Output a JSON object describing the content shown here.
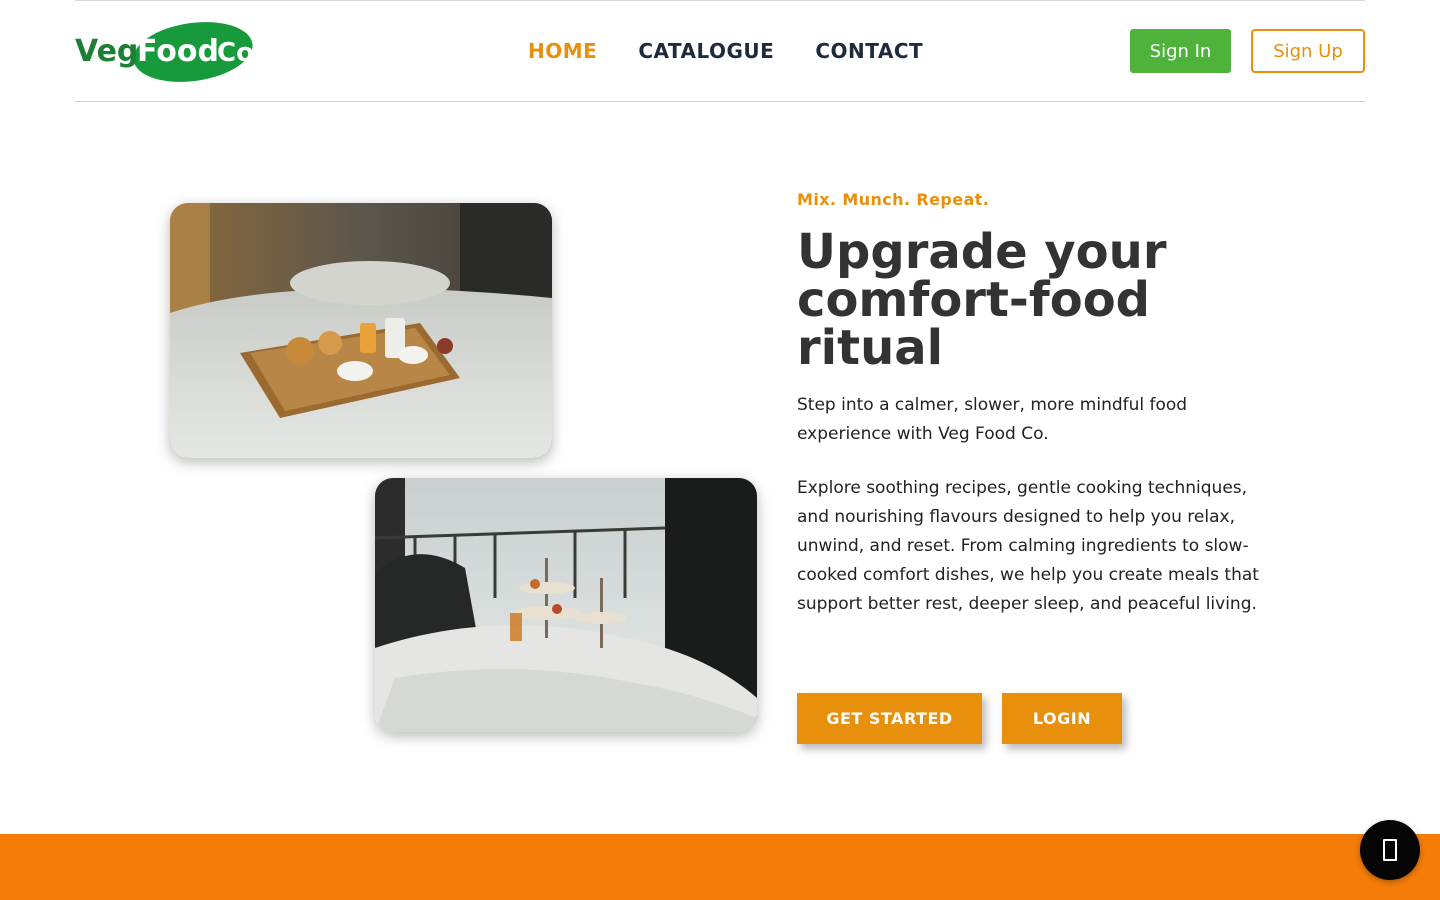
{
  "brand": {
    "logo_text_left": "Veg",
    "logo_text_mid": "Food",
    "logo_text_right": "Co.",
    "colors": {
      "green": "#1c9a3a",
      "orange": "#e8900c",
      "band": "#f57c08"
    }
  },
  "nav": {
    "items": [
      {
        "label": "HOME",
        "active": true
      },
      {
        "label": "CATALOGUE",
        "active": false
      },
      {
        "label": "CONTACT",
        "active": false
      }
    ]
  },
  "auth": {
    "sign_in": "Sign In",
    "sign_up": "Sign Up"
  },
  "hero": {
    "eyebrow": "Mix. Munch. Repeat.",
    "headline": "Upgrade your comfort-food ritual",
    "paragraph1": "Step into a calmer, slower, more mindful food experience with Veg Food Co.",
    "paragraph2": "Explore soothing recipes, gentle cooking techniques, and nourishing flavours designed to help you relax, unwind, and reset. From calming ingredients to slow-cooked comfort dishes, we help you create meals that support better rest, deeper sleep, and peaceful living.",
    "cta_primary": "GET STARTED",
    "cta_secondary": "LOGIN"
  },
  "images": [
    {
      "name": "breakfast-tray-on-bed-photo"
    },
    {
      "name": "tea-stand-on-bed-by-window-photo"
    }
  ],
  "chat": {
    "icon": "chat-icon"
  }
}
